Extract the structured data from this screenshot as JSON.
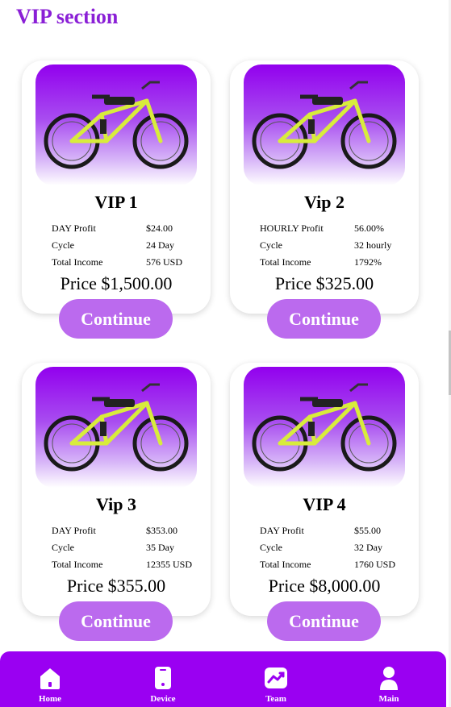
{
  "page": {
    "title": "VIP section"
  },
  "cards": [
    {
      "title": "VIP 1",
      "rows": [
        {
          "label": "DAY Profit",
          "value": "$24.00"
        },
        {
          "label": "Cycle",
          "value": "24 Day"
        },
        {
          "label": "Total Income",
          "value": "576 USD"
        }
      ],
      "price": "Price $1,500.00",
      "button": "Continue"
    },
    {
      "title": "Vip 2",
      "rows": [
        {
          "label": "HOURLY Profit",
          "value": "56.00%"
        },
        {
          "label": "Cycle",
          "value": "32 hourly"
        },
        {
          "label": "Total Income",
          "value": "1792%"
        }
      ],
      "price": "Price $325.00",
      "button": "Continue"
    },
    {
      "title": "Vip 3",
      "rows": [
        {
          "label": "DAY Profit",
          "value": "$353.00"
        },
        {
          "label": "Cycle",
          "value": "35 Day"
        },
        {
          "label": "Total Income",
          "value": "12355 USD"
        }
      ],
      "price": "Price $355.00",
      "button": "Continue"
    },
    {
      "title": "VIP 4",
      "rows": [
        {
          "label": "DAY Profit",
          "value": "$55.00"
        },
        {
          "label": "Cycle",
          "value": "32 Day"
        },
        {
          "label": "Total Income",
          "value": "1760 USD"
        }
      ],
      "price": "Price $8,000.00",
      "button": "Continue"
    }
  ],
  "nav": {
    "items": [
      {
        "label": "Home",
        "icon": "home-icon"
      },
      {
        "label": "Device",
        "icon": "device-icon"
      },
      {
        "label": "Team",
        "icon": "chart-icon"
      },
      {
        "label": "Main",
        "icon": "user-icon"
      }
    ]
  },
  "colors": {
    "accent": "#8a1fd6",
    "button": "#bb6aee",
    "nav_background": "#9a00f2",
    "image_gradient_top": "#9200ee"
  }
}
